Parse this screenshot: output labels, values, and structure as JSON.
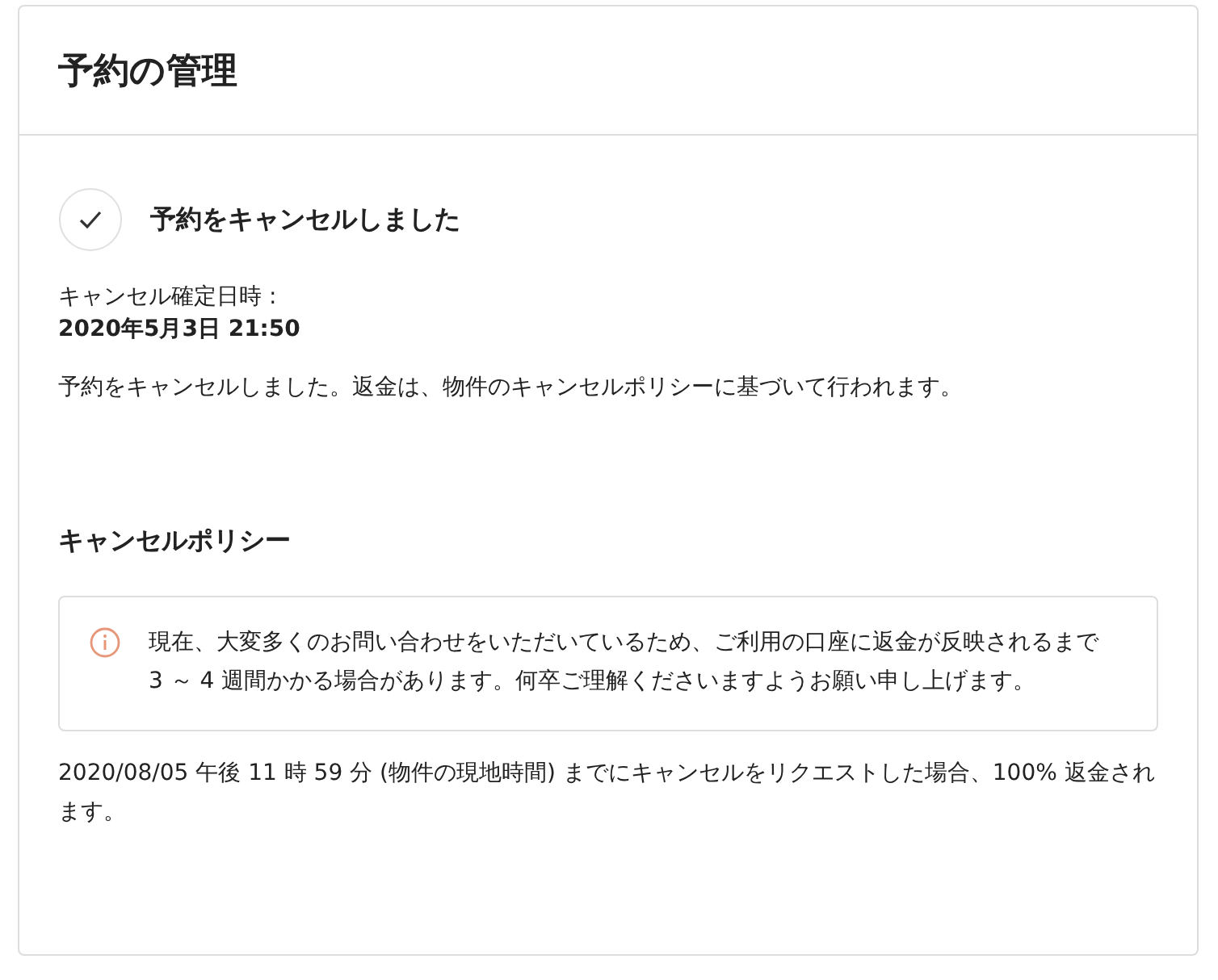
{
  "header": {
    "title": "予約の管理"
  },
  "status": {
    "title": "予約をキャンセルしました"
  },
  "confirmation": {
    "label": "キャンセル確定日時 :",
    "value": "2020年5月3日 21:50"
  },
  "message": "予約をキャンセルしました。返金は、物件のキャンセルポリシーに基づいて行われます。",
  "policy": {
    "heading": "キャンセルポリシー",
    "notice": "現在、大変多くのお問い合わせをいただいているため、ご利用の口座に返金が反映されるまで 3 ～ 4 週間かかる場合があります。何卒ご理解くださいますようお願い申し上げます。",
    "terms": "2020/08/05 午後 11 時 59 分 (物件の現地時間) までにキャンセルをリクエストした場合、100% 返金されます。"
  }
}
